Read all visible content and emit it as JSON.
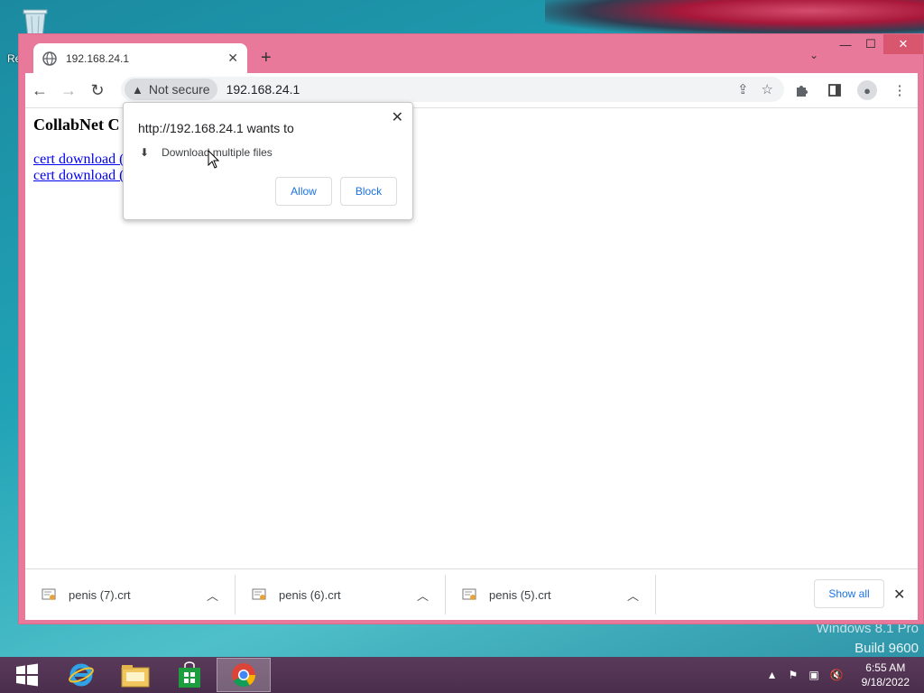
{
  "desktop": {
    "partial_label": "Re",
    "watermark_line1": "Windows 8.1 Pro",
    "watermark_line2": "Build 9600"
  },
  "browser": {
    "tab": {
      "title": "192.168.24.1"
    },
    "window_controls": {
      "minimize": "—",
      "maximize": "☐",
      "close": "✕"
    },
    "omnibox": {
      "security_label": "Not secure",
      "url": "192.168.24.1"
    }
  },
  "page": {
    "heading": "CollabNet C",
    "links": [
      "cert download (",
      "cert download ("
    ]
  },
  "permission_popup": {
    "title": "http://192.168.24.1 wants to",
    "permission": "Download multiple files",
    "allow_label": "Allow",
    "block_label": "Block"
  },
  "downloads": {
    "items": [
      {
        "name": "penis (7).crt"
      },
      {
        "name": "penis (6).crt"
      },
      {
        "name": "penis (5).crt"
      }
    ],
    "show_all_label": "Show all"
  },
  "taskbar": {
    "time": "6:55 AM",
    "date": "9/18/2022"
  },
  "colors": {
    "window_frame": "#e8799a",
    "link": "#0000ee",
    "accent_button": "#1a73e8",
    "taskbar": "#4a2d4c"
  }
}
